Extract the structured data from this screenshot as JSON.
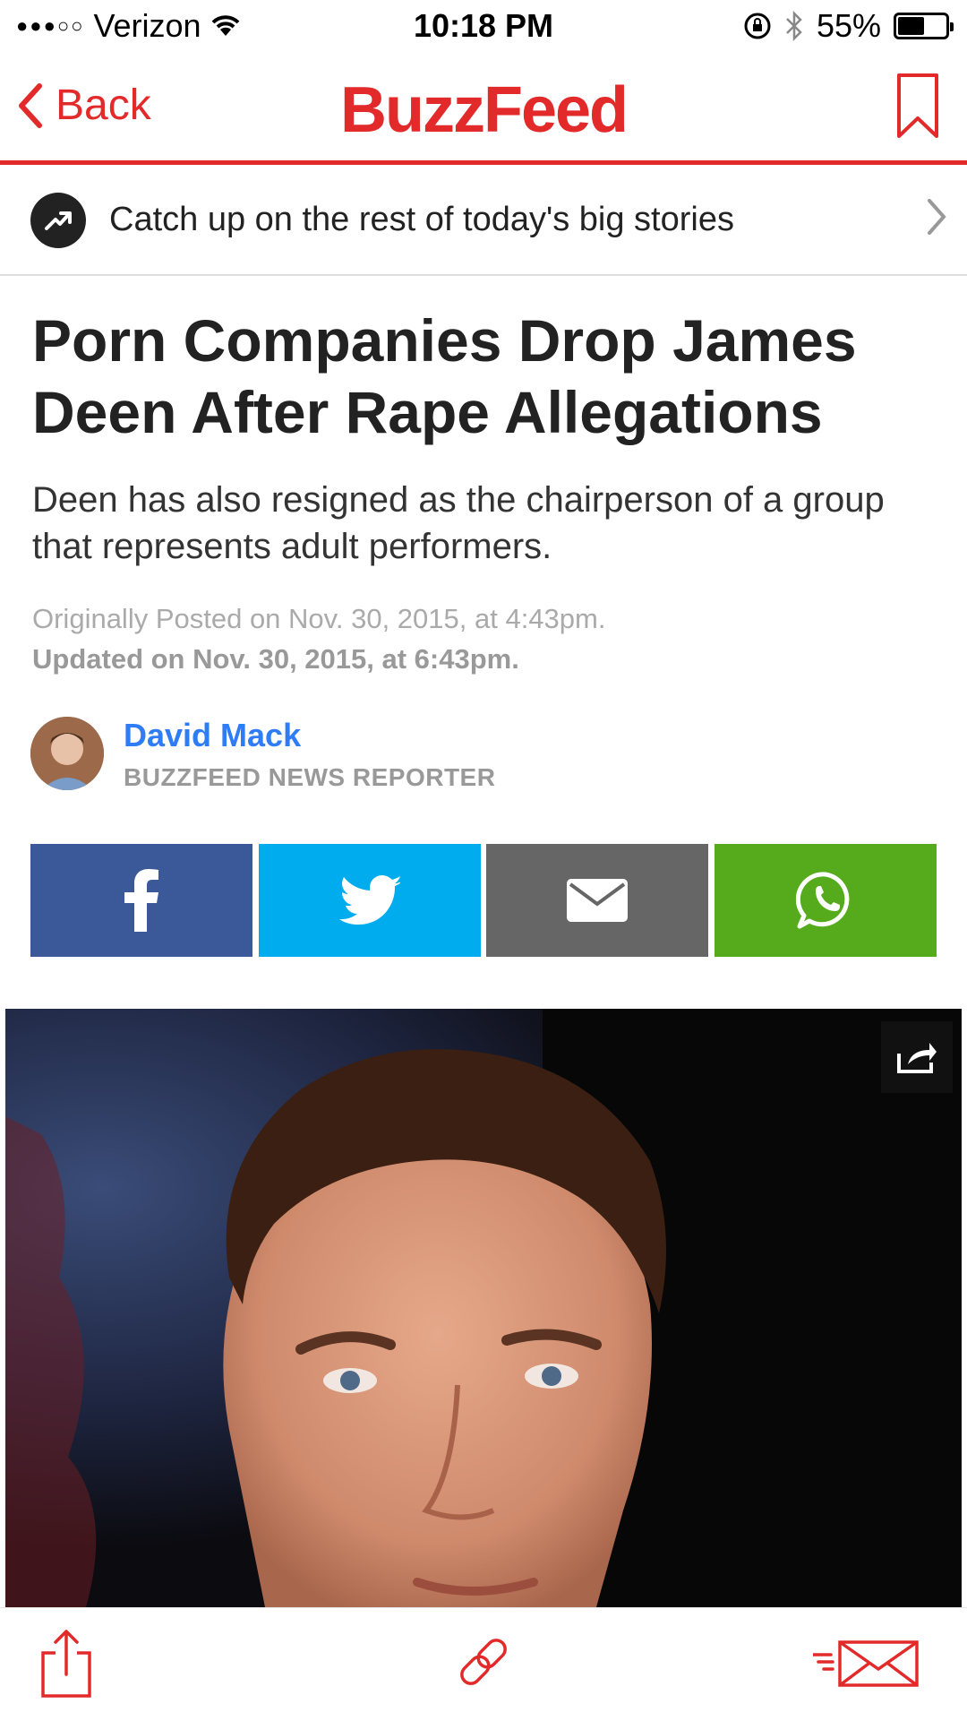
{
  "status_bar": {
    "carrier": "Verizon",
    "time": "10:18 PM",
    "battery": "55%",
    "battery_level": 0.55
  },
  "nav": {
    "back_label": "Back",
    "logo": "BuzzFeed",
    "brand_color": "#e32a2a"
  },
  "catch_up": {
    "text": "Catch up on the rest of today's big stories"
  },
  "article": {
    "title": "Porn Companies Drop James Deen After Rape Allegations",
    "dek": "Deen has also resigned as the chairperson of a group that represents adult performers.",
    "originally_posted": "Originally Posted on Nov. 30, 2015, at 4:43pm.",
    "updated": "Updated on Nov. 30, 2015, at 6:43pm."
  },
  "byline": {
    "author": "David Mack",
    "role": "BUZZFEED NEWS REPORTER"
  },
  "share_buttons": [
    {
      "icon": "facebook-icon",
      "color": "#3b5998"
    },
    {
      "icon": "twitter-icon",
      "color": "#00acee"
    },
    {
      "icon": "email-icon",
      "color": "#666666"
    },
    {
      "icon": "whatsapp-icon",
      "color": "#56ab1c"
    }
  ],
  "toolbar": {
    "items": [
      "share-icon",
      "link-icon",
      "newsletter-icon"
    ]
  }
}
